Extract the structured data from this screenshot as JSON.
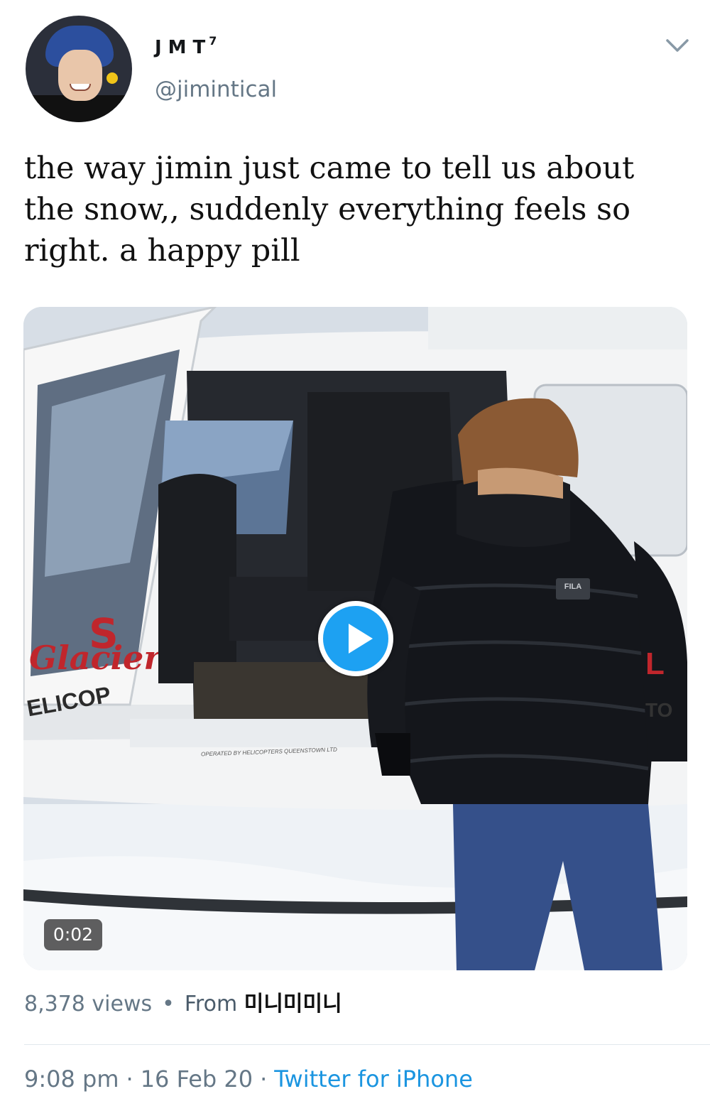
{
  "tweet": {
    "display_name": "JMT",
    "display_name_badge": "7",
    "handle": "@jimintical",
    "text": "the way jimin just came to tell us about the snow,, suddenly everything feels so right. a happy pill",
    "video": {
      "duration": "0:02",
      "overlay_texts": {
        "helicopter_label": "ELICOP",
        "operator_label": "OPERATED BY HELICOPTERS QUEENSTOWN LTD",
        "jacket_logo": "FILA",
        "side_text": "TO",
        "side_letter": "L"
      }
    },
    "views": "8,378 views",
    "from_label": "From",
    "source_user": "미니미미니",
    "time": "9:08 pm",
    "date": "16 Feb 20",
    "client": "Twitter for iPhone"
  },
  "colors": {
    "accent": "#1da1f2",
    "link": "#1b95e0",
    "muted": "#657786"
  },
  "icons": {
    "menu": "chevron-down-icon",
    "play": "play-icon"
  }
}
